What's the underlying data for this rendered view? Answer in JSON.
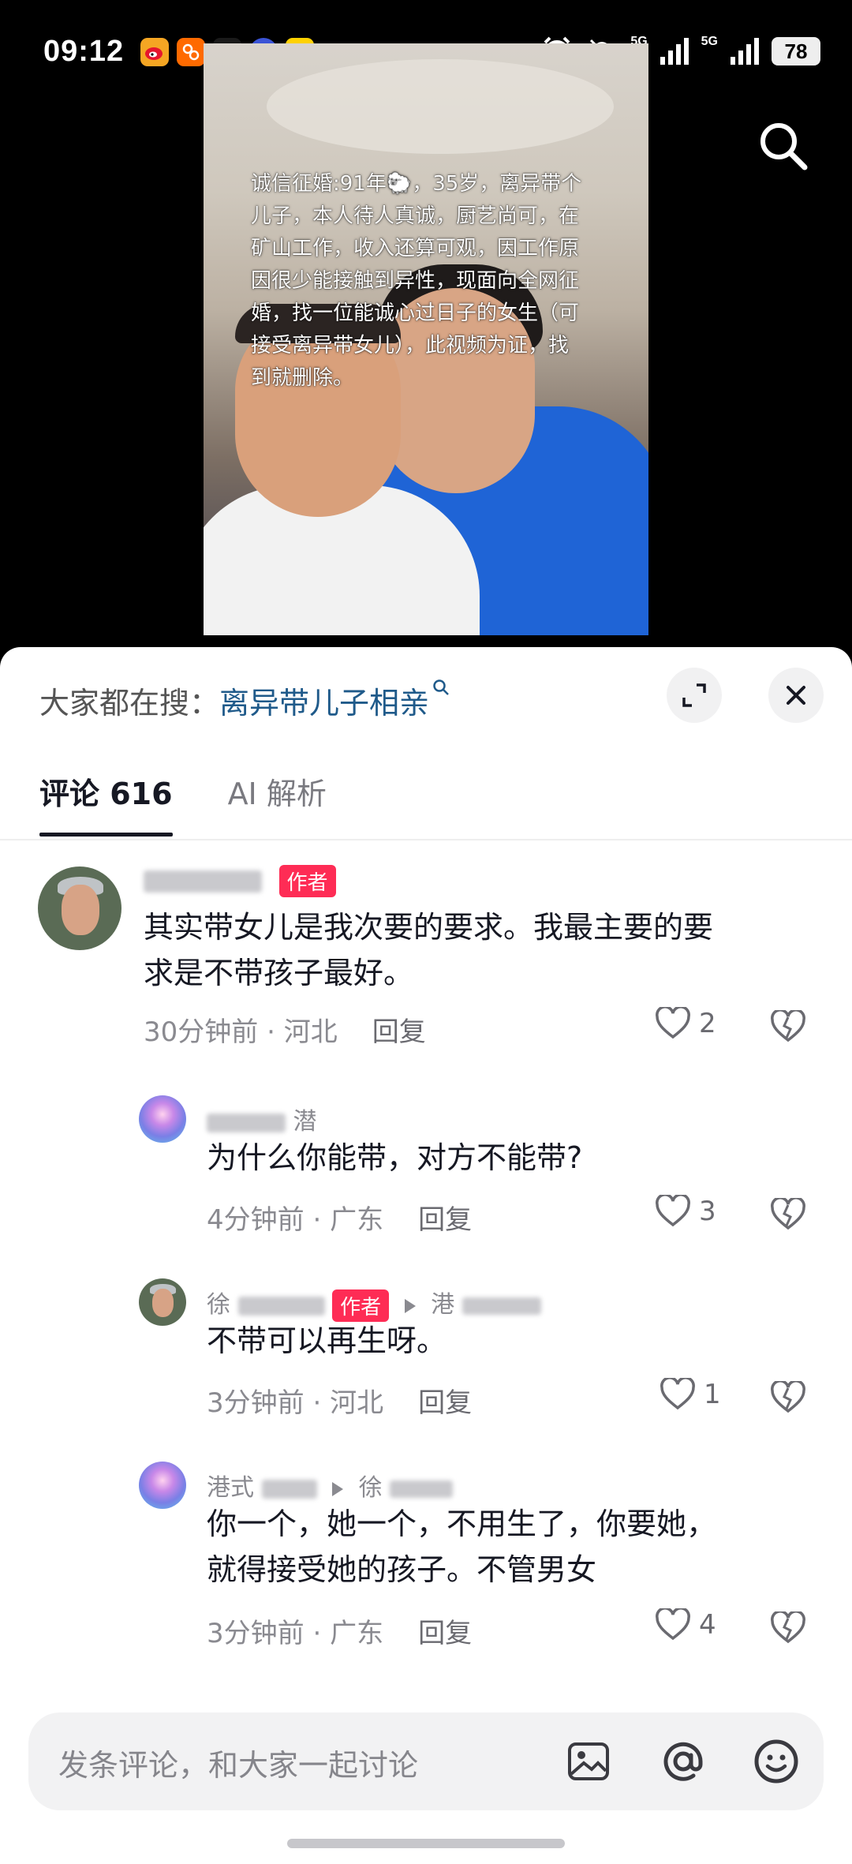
{
  "status_bar": {
    "time": "09:12",
    "app_icons": [
      {
        "icon": "weibo-icon",
        "label": "",
        "color": "#f5a623"
      },
      {
        "icon": "app-orange-icon",
        "label": "",
        "color": "#ff6a00"
      },
      {
        "icon": "dewu-icon",
        "label": "得物",
        "color": "#1a1a1a"
      },
      {
        "icon": "tieba-icon",
        "label": "贴",
        "color": "#3b54d6"
      },
      {
        "icon": "meituan-icon",
        "label": "美团",
        "color": "#ffd100"
      }
    ],
    "signal_1": "5G",
    "signal_2": "5G",
    "battery": "78"
  },
  "video": {
    "overlay_text": "诚信征婚:91年🐑，35岁，离异带个儿子，本人待人真诚，厨艺尚可，在矿山工作，收入还算可观，因工作原因很少能接触到异性，现面向全网征婚，找一位能诚心过日子的女生（可接受离异带女儿），此视频为证，找到就删除。"
  },
  "sheet": {
    "hot_search_prefix": "大家都在搜：",
    "hot_search_term": "离异带儿子相亲",
    "tabs": [
      {
        "label": "评论 616",
        "active": true
      },
      {
        "label": "AI 解析",
        "active": false
      }
    ]
  },
  "comments": [
    {
      "name_suffix": "",
      "author_tag": "作者",
      "text_lines": [
        "其实带女儿是我次要的要求。我最主要的要",
        "求是不带孩子最好。"
      ],
      "time": "30分钟前",
      "sep": " · ",
      "location": "河北",
      "reply": "回复",
      "likes": "2"
    },
    {
      "name_suffix": "潜",
      "text_lines": [
        "为什么你能带，对方不能带?"
      ],
      "time": "4分钟前",
      "sep": " · ",
      "location": "广东",
      "reply": "回复",
      "likes": "3"
    },
    {
      "name_prefix": "徐",
      "author_tag": "作者",
      "reply_to_prefix": "港",
      "text_lines": [
        "不带可以再生呀。"
      ],
      "time": "3分钟前",
      "sep": " · ",
      "location": "河北",
      "reply": "回复",
      "likes": "1"
    },
    {
      "name_prefix": "港式",
      "reply_to_prefix": "徐",
      "text_lines": [
        "你一个，她一个，不用生了，你要她，",
        "就得接受她的孩子。不管男女"
      ],
      "time": "3分钟前",
      "sep": " · ",
      "location": "广东",
      "reply": "回复",
      "likes": "4"
    }
  ],
  "input": {
    "placeholder": "发条评论，和大家一起讨论"
  }
}
